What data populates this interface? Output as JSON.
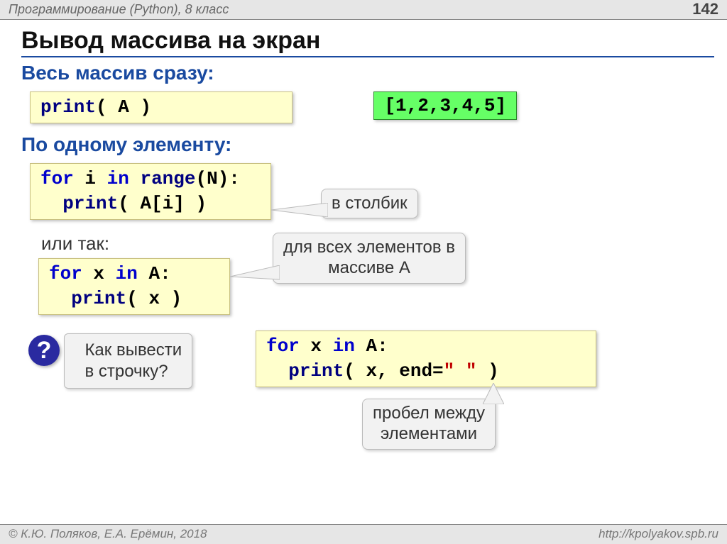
{
  "header": {
    "course": "Программирование (Python), 8 класс",
    "page_number": "142"
  },
  "title": "Вывод массива на экран",
  "section1": {
    "heading": "Весь массив сразу:",
    "code_html": "<span class='kw-navy'>print</span><span class='kw-black'>( A )</span>",
    "output": "[1,2,3,4,5]"
  },
  "section2": {
    "heading": "По одному элементу:",
    "code1_html": "<span class='kw-blue'>for</span> <span class='kw-black'>i</span> <span class='kw-blue'>in</span> <span class='kw-navy'>range</span><span class='kw-black'>(N):</span>\n  <span class='kw-navy'>print</span><span class='kw-black'>( A[i] )</span>",
    "callout1": "в столбик",
    "or_text": "или так:",
    "code2_html": "<span class='kw-blue'>for</span> <span class='kw-black'>x</span> <span class='kw-blue'>in</span> <span class='kw-black'>A:</span>\n  <span class='kw-navy'>print</span><span class='kw-black'>( x )</span>",
    "callout2": "для всех элементов в\nмассиве A"
  },
  "question": {
    "mark": "?",
    "text": "Как вывести\nв строчку?",
    "code_html": "<span class='kw-blue'>for</span> <span class='kw-black'>x</span> <span class='kw-blue'>in</span> <span class='kw-black'>A:</span>\n  <span class='kw-navy'>print</span><span class='kw-black'>( x, end=</span><span class='kw-red'>\" \"</span><span class='kw-black'> )</span>",
    "callout": "пробел между\nэлементами"
  },
  "footer": {
    "left": "© К.Ю. Поляков, Е.А. Ерёмин, 2018",
    "right": "http://kpolyakov.spb.ru"
  }
}
